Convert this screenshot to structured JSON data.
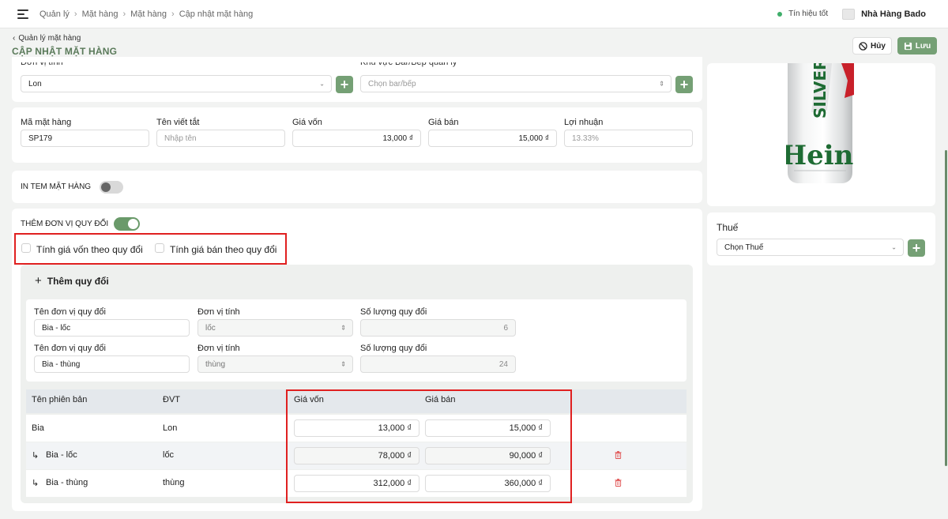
{
  "topbar": {
    "breadcrumb": [
      "Quản lý",
      "Mặt hàng",
      "Mặt hàng",
      "Cập nhật mặt hàng"
    ],
    "signal_text": "Tín hiệu tốt",
    "store_name": "Nhà Hàng Bado"
  },
  "header": {
    "back_label": "Quản lý mặt hàng",
    "title": "CẬP NHẬT MẶT HÀNG",
    "cancel_label": "Hủy",
    "save_label": "Lưu"
  },
  "unit_section": {
    "unit_label": "Đơn vị tính",
    "unit_value": "Lon",
    "area_label": "Khu vực Bar/Bếp quản lý",
    "area_placeholder": "Chọn bar/bếp"
  },
  "item_info": {
    "code_label": "Mã mặt hàng",
    "code_value": "SP179",
    "short_name_label": "Tên viết tắt",
    "short_name_placeholder": "Nhập tên",
    "cost_label": "Giá vốn",
    "cost_value": "13,000 ₫",
    "price_label": "Giá bán",
    "price_value": "15,000 ₫",
    "profit_label": "Lợi nhuận",
    "profit_value": "13.33%"
  },
  "print_label": {
    "label": "IN TEM MẶT HÀNG",
    "enabled": false
  },
  "conversion": {
    "label": "THÊM ĐƠN VỊ QUY ĐỔI",
    "enabled": true,
    "cost_by_conversion_label": "Tính giá vốn theo quy đổi",
    "price_by_conversion_label": "Tính giá bán theo quy đổi",
    "add_label": "Thêm quy đổi",
    "units": [
      {
        "name_label": "Tên đơn vị quy đổi",
        "name_value": "Bia - lốc",
        "unit_label": "Đơn vị tính",
        "unit_value": "lốc",
        "qty_label": "Số lượng quy đổi",
        "qty_value": "6"
      },
      {
        "name_label": "Tên đơn vị quy đổi",
        "name_value": "Bia - thùng",
        "unit_label": "Đơn vị tính",
        "unit_value": "thùng",
        "qty_label": "Số lượng quy đổi",
        "qty_value": "24"
      }
    ]
  },
  "variants_table": {
    "headers": [
      "Tên phiên bản",
      "ĐVT",
      "Giá vốn",
      "Giá bán"
    ],
    "rows": [
      {
        "name": "Bia",
        "child": false,
        "unit": "Lon",
        "cost": "13,000 ₫",
        "price": "15,000 ₫",
        "deletable": false
      },
      {
        "name": "Bia - lốc",
        "child": true,
        "unit": "lốc",
        "cost": "78,000 ₫",
        "price": "90,000 ₫",
        "deletable": true
      },
      {
        "name": "Bia - thùng",
        "child": true,
        "unit": "thùng",
        "cost": "312,000 ₫",
        "price": "360,000 ₫",
        "deletable": true
      }
    ]
  },
  "product_image": {
    "brand_text": "Heineken",
    "variant_text": "SILVER"
  },
  "tax": {
    "label": "Thuế",
    "placeholder": "Chọn Thuế"
  },
  "colors": {
    "accent": "#75a075",
    "title": "#5a7a5a",
    "highlight": "#e02020",
    "delete": "#e05050"
  }
}
